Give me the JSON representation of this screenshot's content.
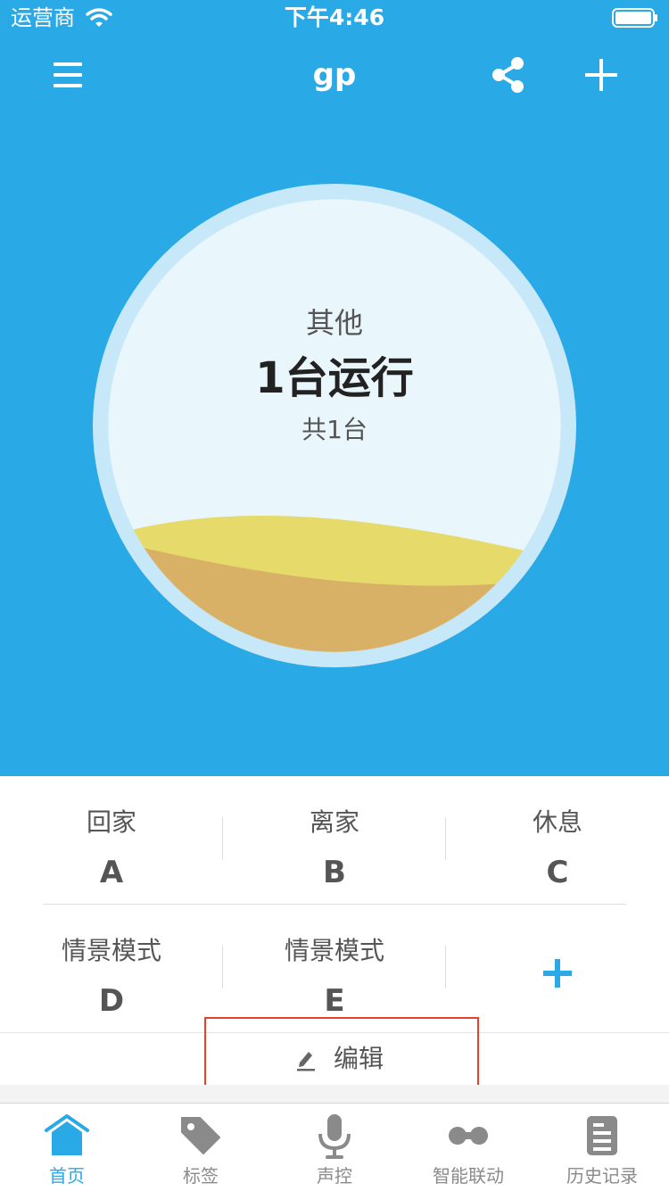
{
  "status_bar": {
    "carrier": "运营商",
    "time": "下午4:46"
  },
  "nav": {
    "title": "gp"
  },
  "summary": {
    "category": "其他",
    "running": "1台运行",
    "total": "共1台"
  },
  "scenes": [
    {
      "name": "回家",
      "letter": "A"
    },
    {
      "name": "离家",
      "letter": "B"
    },
    {
      "name": "休息",
      "letter": "C"
    },
    {
      "name": "情景模式",
      "letter": "D"
    },
    {
      "name": "情景模式",
      "letter": "E"
    }
  ],
  "edit": {
    "label": "编辑"
  },
  "tabs": [
    {
      "label": "首页",
      "icon": "home-icon"
    },
    {
      "label": "标签",
      "icon": "tag-icon"
    },
    {
      "label": "声控",
      "icon": "microphone-icon"
    },
    {
      "label": "智能联动",
      "icon": "link-icon"
    },
    {
      "label": "历史记录",
      "icon": "history-icon"
    }
  ],
  "colors": {
    "primary": "#29a9e6",
    "wave_yellow": "#e6da6a",
    "wave_orange": "#d8b066",
    "highlight": "#e8402a"
  }
}
